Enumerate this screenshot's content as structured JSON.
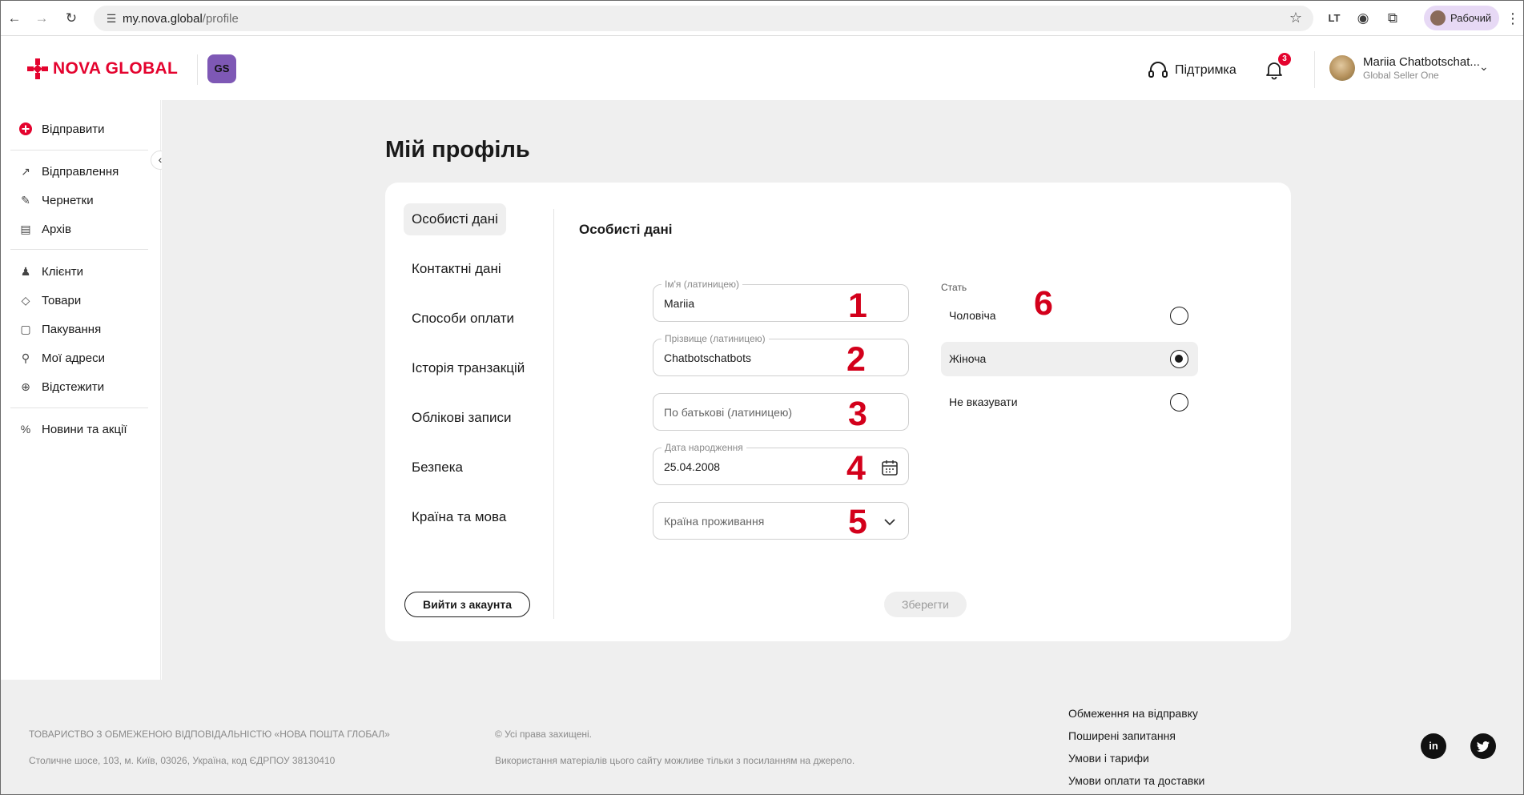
{
  "browser": {
    "url_host": "my.nova.global",
    "url_path": "/profile",
    "profile_label": "Рабочий"
  },
  "header": {
    "logo_text": "NOVA GLOBAL",
    "gs_badge": "GS",
    "support_label": "Підтримка",
    "notification_count": "3",
    "user_name": "Mariia Chatbotschat...",
    "user_subtitle": "Global Seller One"
  },
  "sidebar": {
    "send": "Відправити",
    "items": [
      {
        "label": "Відправлення",
        "icon": "arrow-up-right-icon"
      },
      {
        "label": "Чернетки",
        "icon": "edit-icon"
      },
      {
        "label": "Архів",
        "icon": "archive-icon"
      },
      {
        "label": "Клієнти",
        "icon": "users-icon"
      },
      {
        "label": "Товари",
        "icon": "tag-icon"
      },
      {
        "label": "Пакування",
        "icon": "box-icon"
      },
      {
        "label": "Мої адреси",
        "icon": "map-pin-icon"
      },
      {
        "label": "Відстежити",
        "icon": "crosshair-icon"
      },
      {
        "label": "Новини та акції",
        "icon": "percent-icon"
      }
    ]
  },
  "main": {
    "page_title": "Мій профіль",
    "tabs": [
      {
        "label": "Особисті дані",
        "active": true
      },
      {
        "label": "Контактні дані",
        "active": false
      },
      {
        "label": "Способи оплати",
        "active": false
      },
      {
        "label": "Історія транзакцій",
        "active": false
      },
      {
        "label": "Облікові записи",
        "active": false
      },
      {
        "label": "Безпека",
        "active": false
      },
      {
        "label": "Країна та мова",
        "active": false
      }
    ],
    "logout_label": "Вийти з акаунта",
    "section_title": "Особисті дані",
    "fields": {
      "first_name": {
        "label": "Ім'я (латиницею)",
        "value": "Mariia"
      },
      "last_name": {
        "label": "Прізвище (латиницею)",
        "value": "Chatbotschatbots"
      },
      "patronymic": {
        "placeholder": "По батькові (латиницею)"
      },
      "birth_date": {
        "label": "Дата народження",
        "value": "25.04.2008"
      },
      "country": {
        "placeholder": "Країна проживання"
      }
    },
    "gender": {
      "label": "Стать",
      "options": [
        {
          "label": "Чоловіча",
          "selected": false
        },
        {
          "label": "Жіноча",
          "selected": true
        },
        {
          "label": "Не вказувати",
          "selected": false
        }
      ]
    },
    "save_label": "Зберегти",
    "annotations": [
      "1",
      "2",
      "3",
      "4",
      "5",
      "6"
    ]
  },
  "footer": {
    "company": "ТОВАРИСТВО З ОБМЕЖЕНОЮ ВІДПОВІДАЛЬНІСТЮ «НОВА ПОШТА ГЛОБАЛ»",
    "address": "Столичне шосе, 103, м. Київ, 03026, Україна, код ЄДРПОУ 38130410",
    "rights": "© Усі права захищені.",
    "usage": "Використання матеріалів цього сайту можливе тільки з посиланням на джерело.",
    "links": [
      "Обмеження на відправку",
      "Поширені запитання",
      "Умови і тарифи",
      "Умови оплати та доставки"
    ],
    "social": [
      "in",
      "twitter"
    ]
  },
  "colors": {
    "brand_red": "#e4032e",
    "annotation_red": "#d3001b",
    "gs_purple": "#7e58b5",
    "page_bg": "#efefef"
  }
}
